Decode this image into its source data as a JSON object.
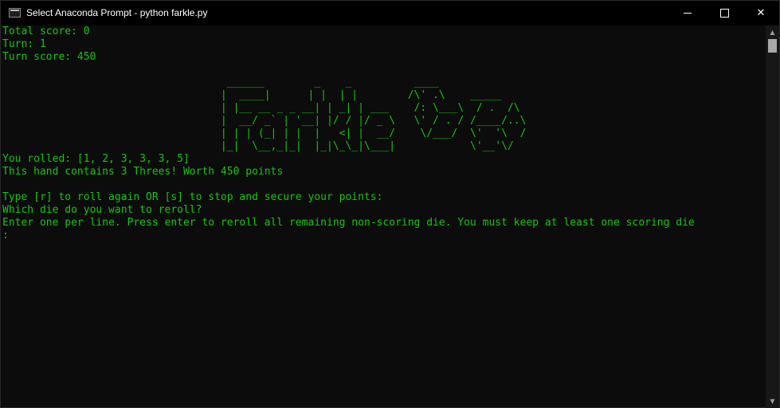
{
  "window": {
    "title": "Select Anaconda Prompt - python  farkle.py",
    "minimize_glyph": "minimize-icon",
    "maximize_glyph": "maximize-icon",
    "close_glyph": "✕"
  },
  "console": {
    "text_color": "#16c60c",
    "background": "#0c0c0c",
    "stats": [
      "Total score: 0",
      "Turn: 1",
      "Turn score: 450"
    ],
    "banner": [
      "",
      "                                    ______        _    _          ____",
      "                                   |  ____|      | |  | |        /\\' .\\    _____",
      "                                   | |__ __ _ _ __| | _| | ___    /: \\___\\  / .  /\\",
      "                                   |  __/ _` | '__| |/ / |/ _ \\   \\' / . / /____/..\\",
      "                                   | | | (_| | |  |   <| |  __/    \\/___/  \\'  '\\  /",
      "                                   |_|  \\__,_|_|  |_|\\_\\_|\\___|            \\'__'\\/",
      ""
    ],
    "roll_line": "You rolled: [1, 2, 3, 3, 3, 5]",
    "hand_line": "This hand contains 3 Threes! Worth 450 points",
    "prompt_lines": [
      "Type [r] to roll again OR [s] to stop and secure your points:",
      "Which die do you want to reroll?",
      "Enter one per line. Press enter to reroll all remaining non-scoring die. You must keep at least one scoring die",
      ":"
    ]
  }
}
